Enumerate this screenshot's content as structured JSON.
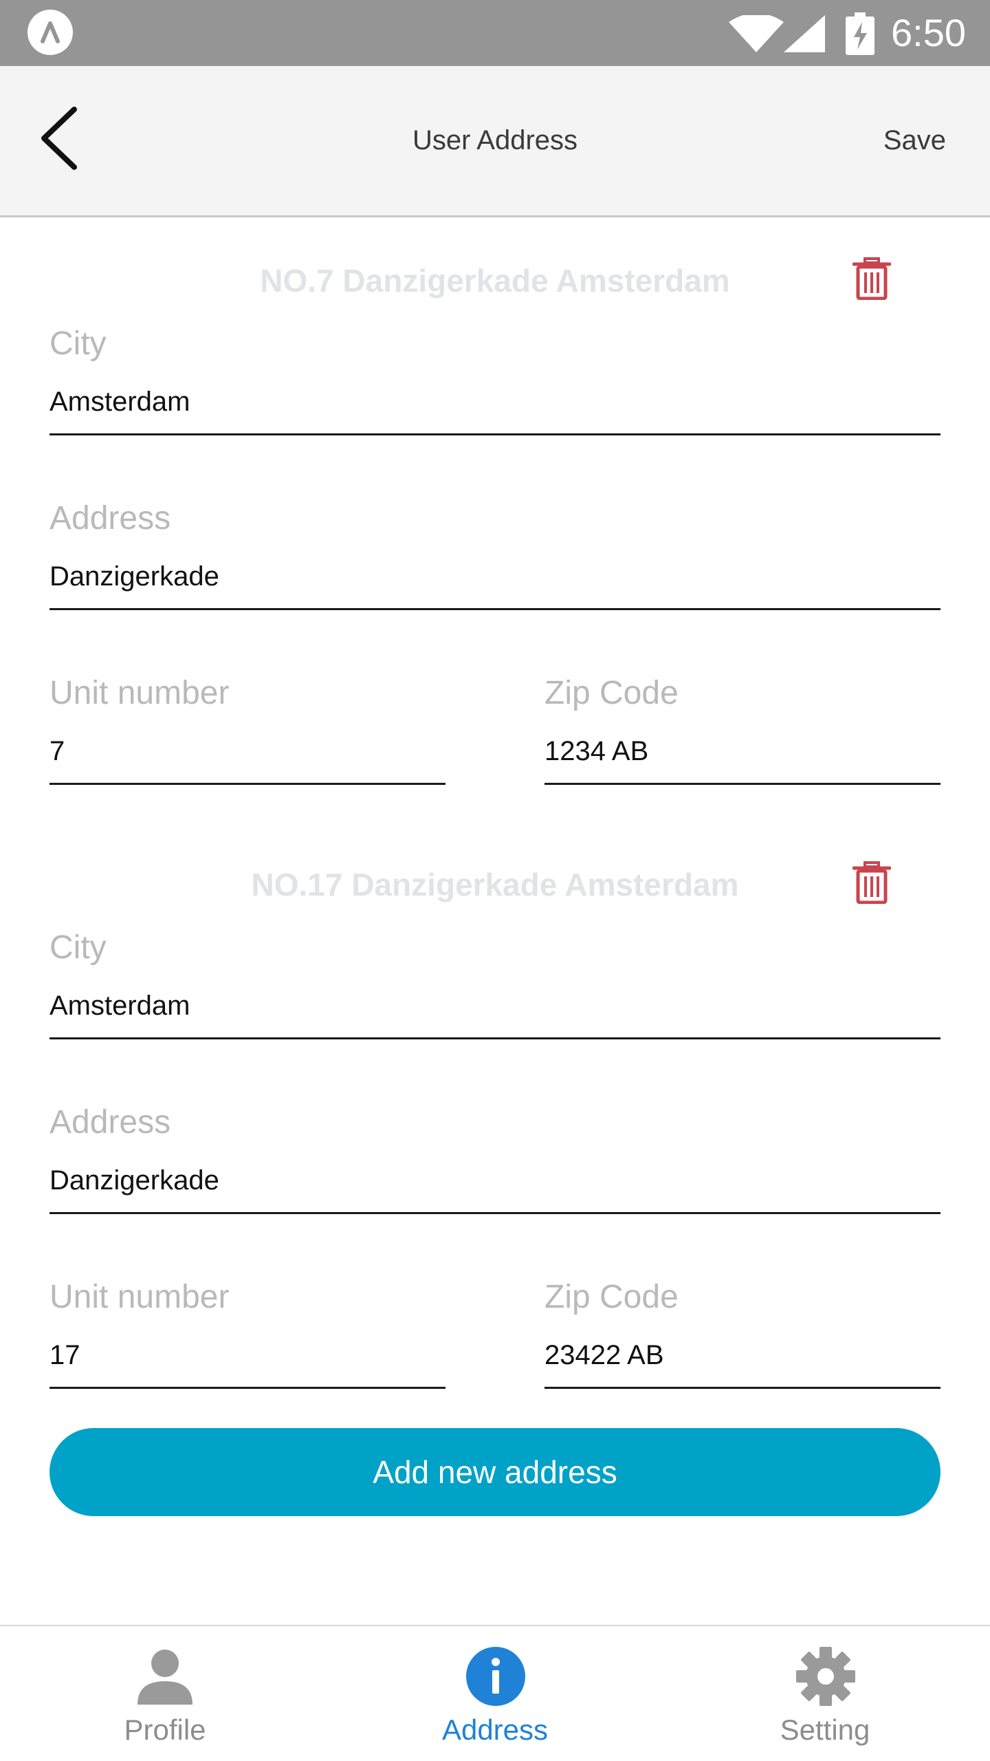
{
  "status_bar": {
    "time": "6:50"
  },
  "header": {
    "title": "User Address",
    "save_label": "Save"
  },
  "addresses": [
    {
      "heading": "NO.7 Danzigerkade Amsterdam",
      "city_label": "City",
      "city": "Amsterdam",
      "address_label": "Address",
      "address": "Danzigerkade",
      "unit_label": "Unit number",
      "unit": "7",
      "zip_label": "Zip Code",
      "zip": "1234 AB"
    },
    {
      "heading": "NO.17 Danzigerkade Amsterdam",
      "city_label": "City",
      "city": "Amsterdam",
      "address_label": "Address",
      "address": "Danzigerkade",
      "unit_label": "Unit number",
      "unit": "17",
      "zip_label": "Zip Code",
      "zip": "23422 AB"
    }
  ],
  "add_button_label": "Add new address",
  "bottom_nav": {
    "items": [
      {
        "label": "Profile",
        "icon": "person-icon"
      },
      {
        "label": "Address",
        "icon": "info-icon",
        "active": true
      },
      {
        "label": "Setting",
        "icon": "gear-icon"
      }
    ]
  },
  "colors": {
    "accent": "#00a2c7",
    "active_nav": "#1f82d6",
    "delete": "#c9444d",
    "status_bar": "#959595"
  }
}
